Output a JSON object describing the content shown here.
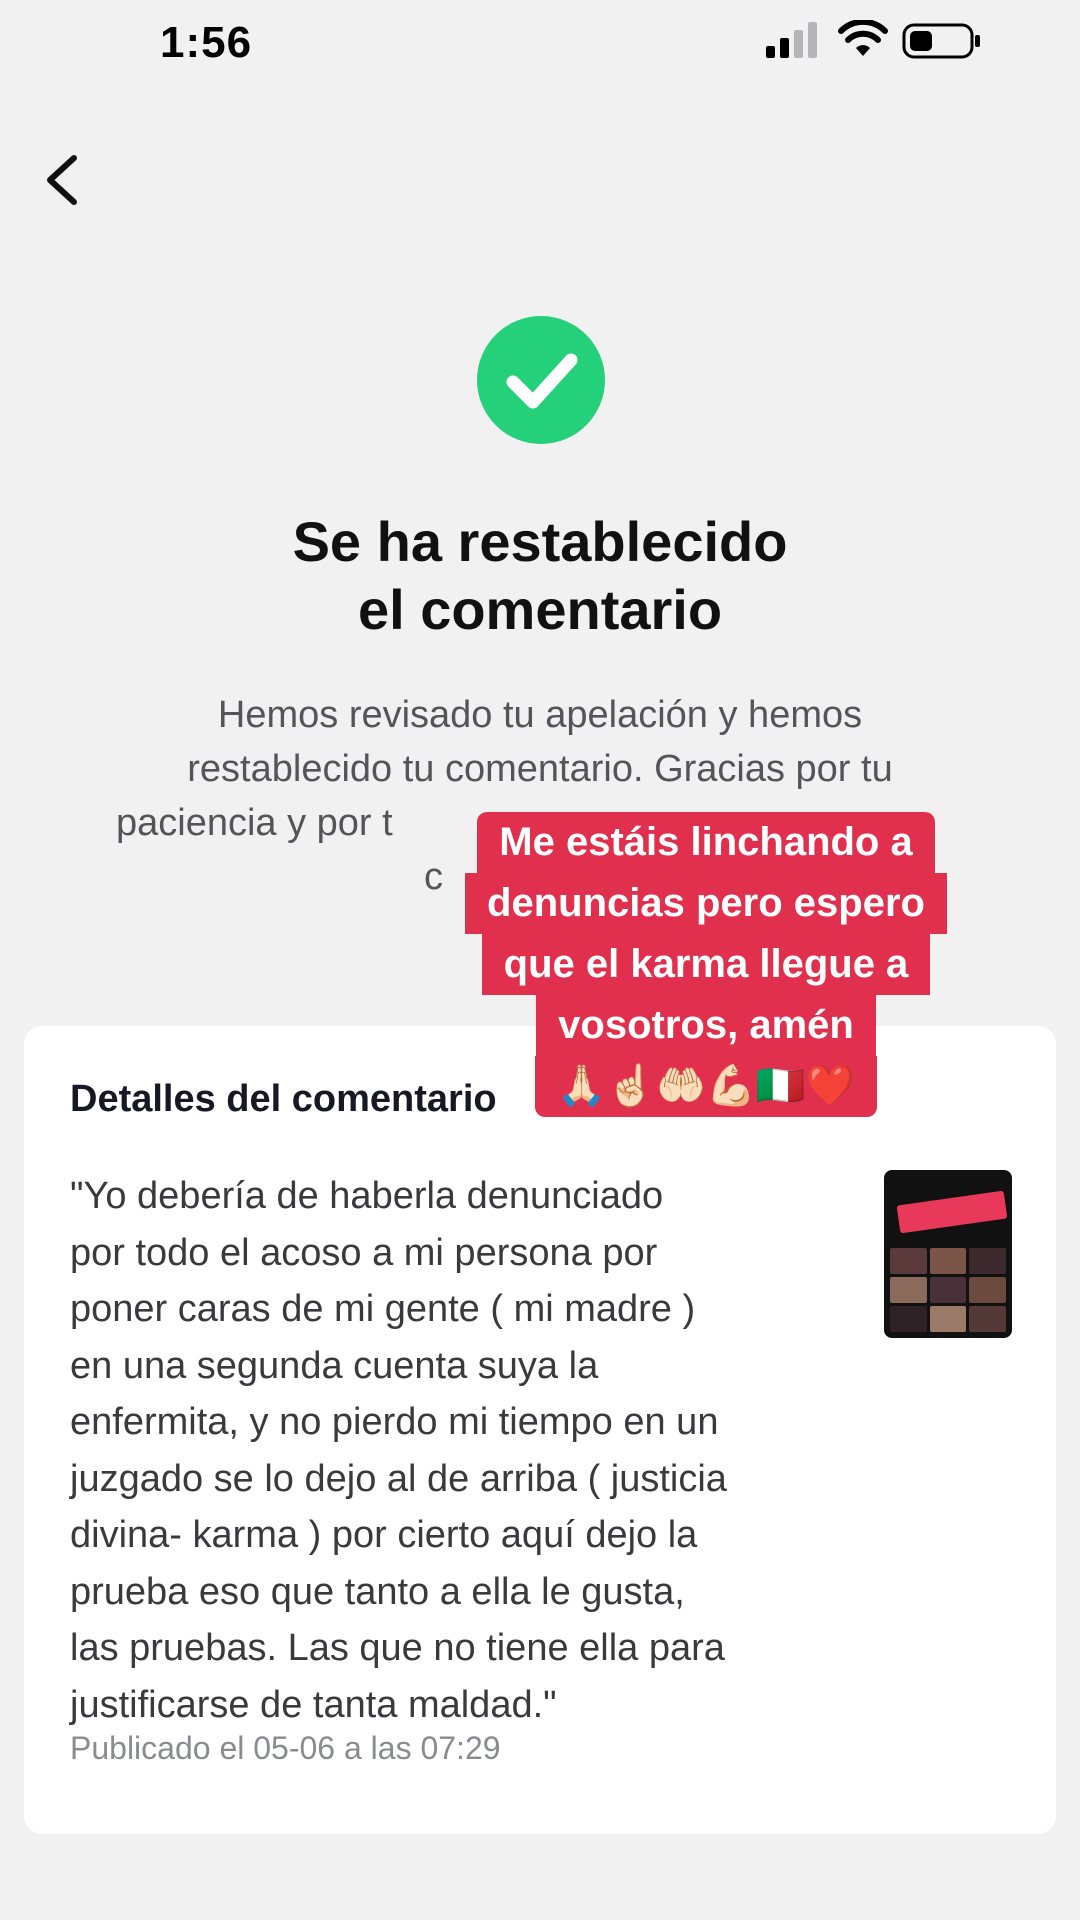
{
  "status_bar": {
    "time": "1:56"
  },
  "header": {
    "back_icon": "chevron-left-icon"
  },
  "result": {
    "icon": "check-circle-icon",
    "icon_color": "#25d07a",
    "title_lines": [
      "Se ha restablecido",
      "el comentario"
    ],
    "description_lines": [
      "Hemos revisado tu apelación y hemos",
      "restablecido tu comentario. Gracias por tu",
      "paciencia y por t",
      "c"
    ]
  },
  "comment_details": {
    "title": "Detalles del comentario",
    "text_lines": [
      "\"Yo debería de haberla denunciado",
      "por todo el acoso a mi persona por",
      "poner caras de mi gente ( mi madre )",
      "en una segunda cuenta suya la",
      "enfermita, y no pierdo mi tiempo en un",
      "juzgado se lo dejo al de arriba ( justicia",
      "divina- karma ) por cierto aquí dejo la",
      "prueba eso que tanto a ella le gusta,",
      "las pruebas. Las que no tiene ella para",
      "justificarse de tanta maldad.\""
    ],
    "published": "Publicado el 05-06 a las 07:29",
    "thumbnail": "video-thumbnail"
  },
  "overlay_caption": {
    "lines": [
      "Me estáis linchando a",
      "denuncias pero espero",
      "que el karma llegue a",
      "vosotros, amén",
      "🙏🏻☝🏻🤲🏻💪🏻🇮🇹❤️"
    ],
    "background_color": "#e0304e"
  }
}
